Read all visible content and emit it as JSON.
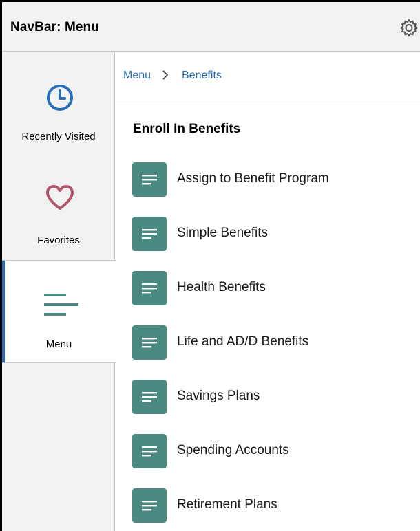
{
  "header": {
    "title": "NavBar: Menu",
    "settings_icon": "gear-icon"
  },
  "sidebar": {
    "items": [
      {
        "label": "Recently Visited",
        "icon": "clock-icon",
        "icon_color": "#2a6ebb",
        "active": false
      },
      {
        "label": "Favorites",
        "icon": "heart-icon",
        "icon_color": "#b0556a",
        "active": false
      },
      {
        "label": "Menu",
        "icon": "hamburger-icon",
        "icon_color": "#4a8a80",
        "active": true
      }
    ]
  },
  "breadcrumb": {
    "items": [
      "Menu",
      "Benefits"
    ],
    "separator_icon": "chevron-right-icon"
  },
  "main": {
    "section_title": "Enroll In Benefits",
    "items": [
      {
        "label": "Assign to Benefit Program",
        "icon": "document-lines-icon"
      },
      {
        "label": "Simple Benefits",
        "icon": "document-lines-icon"
      },
      {
        "label": "Health Benefits",
        "icon": "document-lines-icon"
      },
      {
        "label": "Life and AD/D Benefits",
        "icon": "document-lines-icon"
      },
      {
        "label": "Savings Plans",
        "icon": "document-lines-icon"
      },
      {
        "label": "Spending Accounts",
        "icon": "document-lines-icon"
      },
      {
        "label": "Retirement Plans",
        "icon": "document-lines-icon"
      }
    ]
  },
  "colors": {
    "accent": "#2a6ebb",
    "tile": "#4a8a80",
    "header_bg": "#f2f2f2"
  }
}
